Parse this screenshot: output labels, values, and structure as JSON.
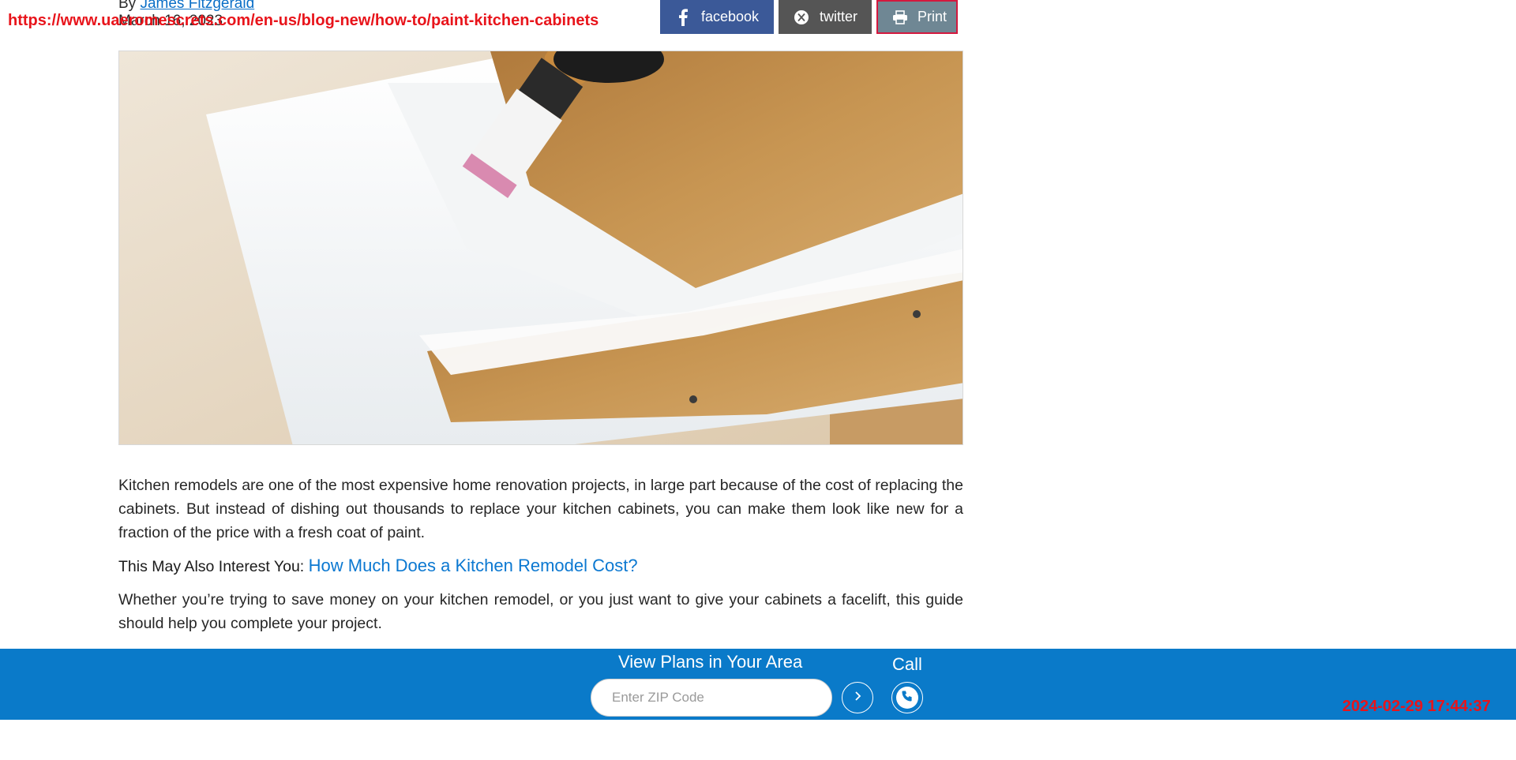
{
  "byline": {
    "prefix": "By",
    "author": "James Fitzgerald"
  },
  "date": "March 16, 2023",
  "overlay_url": "https://www.uaeromescrets.com/en-us/blog-new/how-to/paint-kitchen-cabinets",
  "share": {
    "facebook_label": "facebook",
    "twitter_label": "twitter",
    "print_label": "Print"
  },
  "article": {
    "paragraph1": "Kitchen remodels are one of the most expensive home renovation projects, in large part because of the cost of replacing the cabinets. But instead of dishing out thousands to replace your kitchen cabinets, you can make them look like new for a fraction of the price with a fresh coat of paint.",
    "interest_label": "This May Also Interest You:",
    "interest_link": "How Much Does a Kitchen Remodel Cost?",
    "paragraph2": "Whether you’re trying to save money on your kitchen remodel, or you just want to give your cabinets a facelift, this guide should help you complete your project."
  },
  "cta": {
    "title": "View Plans in Your Area",
    "zip_placeholder": "Enter ZIP Code",
    "call_label": "Call"
  },
  "timestamp": "2024-02-29 17:44:37",
  "colors": {
    "facebook": "#3b5998",
    "twitter": "#555555",
    "print": "#6f8794",
    "cta_bar": "#0a7ac9",
    "overlay_red": "#e8141b",
    "link_blue": "#0b78d1"
  }
}
